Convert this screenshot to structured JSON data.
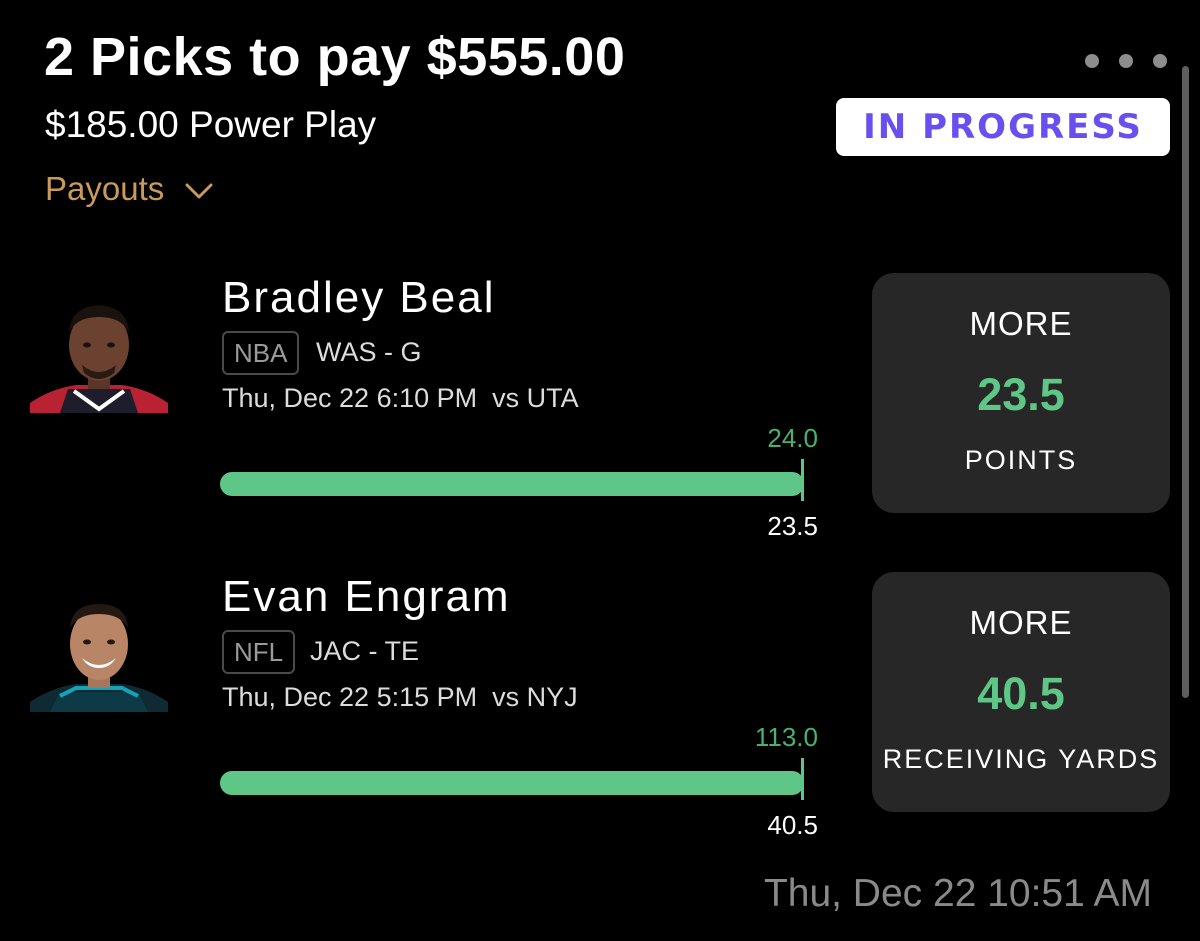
{
  "header": {
    "title": "2 Picks to pay $555.00",
    "subtitle": "$185.00 Power Play",
    "payouts_label": "Payouts",
    "status": "IN PROGRESS"
  },
  "picks": [
    {
      "player": "Bradley Beal",
      "league": "NBA",
      "team_position": "WAS - G",
      "game_time": "Thu, Dec 22 6:10 PM  vs UTA",
      "current_value": "24.0",
      "line_value": "23.5",
      "progress": 1.0,
      "direction": "MORE",
      "line": "23.5",
      "stat": "POINTS"
    },
    {
      "player": "Evan Engram",
      "league": "NFL",
      "team_position": "JAC - TE",
      "game_time": "Thu, Dec 22 5:15 PM  vs NYJ",
      "current_value": "113.0",
      "line_value": "40.5",
      "progress": 1.0,
      "direction": "MORE",
      "line": "40.5",
      "stat": "RECEIVING YARDS"
    }
  ],
  "footer": {
    "timestamp": "Thu, Dec 22 10:51 AM"
  },
  "colors": {
    "accent_green": "#5ec787",
    "payouts_gold": "#c99a5b",
    "status_purple": "#6a4ff0",
    "card_bg": "#272727"
  }
}
